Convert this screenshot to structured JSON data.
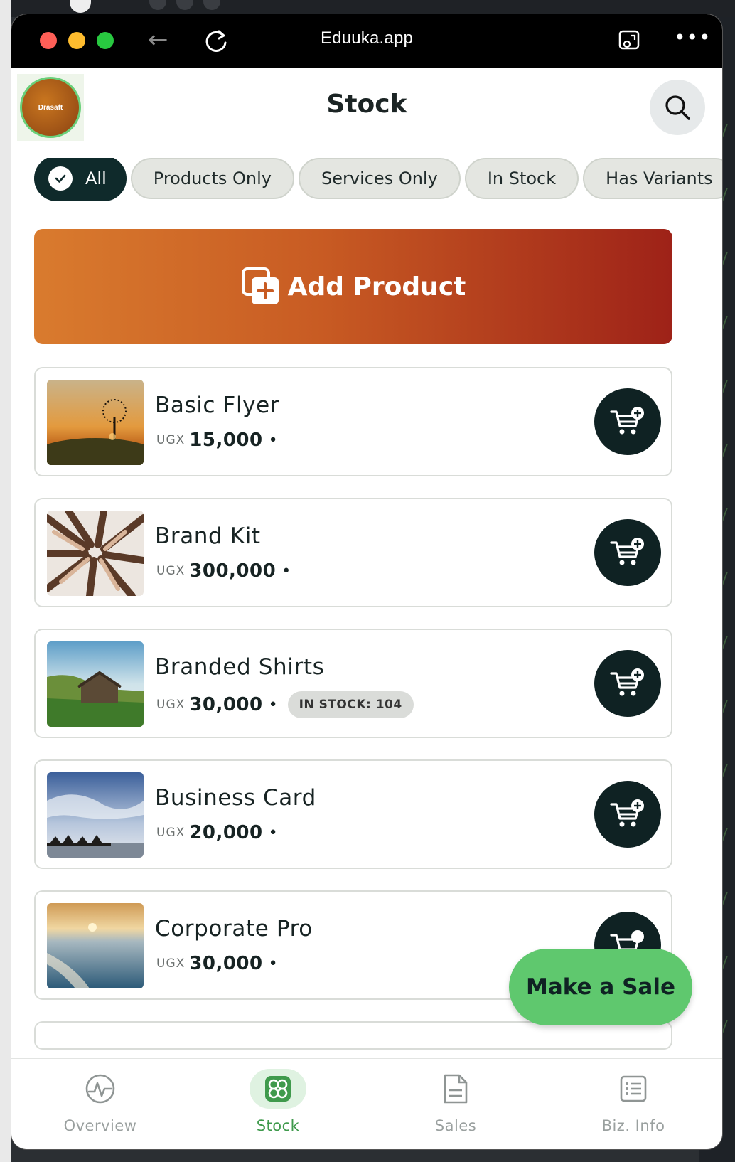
{
  "browser": {
    "url": "Eduuka.app"
  },
  "header": {
    "logo_text": "Drasaft",
    "title": "Stock"
  },
  "filters": [
    {
      "label": "All",
      "active": true
    },
    {
      "label": "Products Only",
      "active": false
    },
    {
      "label": "Services Only",
      "active": false
    },
    {
      "label": "In Stock",
      "active": false
    },
    {
      "label": "Has Variants",
      "active": false
    }
  ],
  "add_product": {
    "label": "Add Product"
  },
  "products": [
    {
      "name": "Basic Flyer",
      "currency": "UGX",
      "price": "15,000",
      "stock": null,
      "image": "sunset-tree"
    },
    {
      "name": "Brand Kit",
      "currency": "UGX",
      "price": "300,000",
      "stock": null,
      "image": "hands-circle"
    },
    {
      "name": "Branded Shirts",
      "currency": "UGX",
      "price": "30,000",
      "stock": "IN STOCK: 104",
      "image": "hut-meadow"
    },
    {
      "name": "Business Card",
      "currency": "UGX",
      "price": "20,000",
      "stock": null,
      "image": "sky-huts"
    },
    {
      "name": "Corporate Pro",
      "currency": "UGX",
      "price": "30,000",
      "stock": null,
      "image": "sea-sunset"
    }
  ],
  "fab": {
    "label": "Make a Sale"
  },
  "bottom_nav": [
    {
      "label": "Overview",
      "icon": "activity-icon",
      "active": false
    },
    {
      "label": "Stock",
      "icon": "box-icon",
      "active": true
    },
    {
      "label": "Sales",
      "icon": "document-icon",
      "active": false
    },
    {
      "label": "Biz. Info",
      "icon": "list-icon",
      "active": false
    }
  ],
  "colors": {
    "brand_dark": "#0f2223",
    "accent_green": "#5fc86e",
    "add_gradient_start": "#d97b2e",
    "add_gradient_end": "#9e2218"
  }
}
